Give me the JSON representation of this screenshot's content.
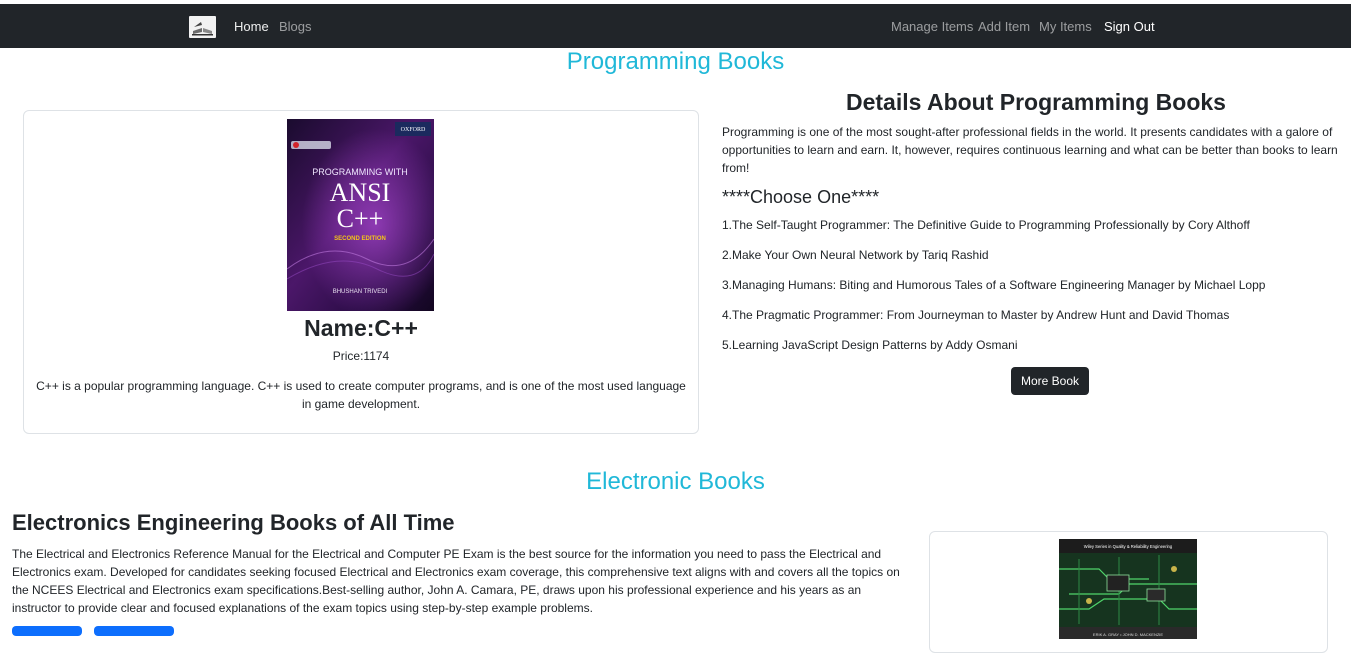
{
  "nav": {
    "links": {
      "home": "Home",
      "blogs": "Blogs",
      "manage": "Manage Items",
      "add": "Add Item",
      "my": "My Items",
      "signout": "Sign Out"
    }
  },
  "programming": {
    "section_title": "Programming Books",
    "card": {
      "cover": {
        "publisher": "OXFORD",
        "line1": "PROGRAMMING WITH",
        "line2": "ANSI",
        "line3": "C++",
        "edition": "SECOND EDITION",
        "author": "BHUSHAN TRIVEDI"
      },
      "name": "Name:C++",
      "price": "Price:1174",
      "description": "C++ is a popular programming language. C++ is used to create computer programs, and is one of the most used language in game development."
    },
    "details": {
      "title": "Details About Programming Books",
      "paragraph": "Programming is one of the most sought-after professional fields in the world. It presents candidates with a galore of opportunities to learn and earn. It, however, requires continuous learning and what can be better than books to learn from!",
      "choose": "****Choose One****",
      "list": [
        "1.The Self-Taught Programmer: The Definitive Guide to Programming Professionally by Cory Althoff",
        "2.Make Your Own Neural Network by Tariq Rashid",
        "3.Managing Humans: Biting and Humorous Tales of a Software Engineering Manager by Michael Lopp",
        "4.The Pragmatic Programmer: From Journeyman to Master by Andrew Hunt and David Thomas",
        "5.Learning JavaScript Design Patterns by Addy Osmani"
      ],
      "more_button": "More Book"
    }
  },
  "electronic": {
    "section_title": "Electronic Books",
    "heading": "Electronics Engineering Books of All Time",
    "paragraph": "The Electrical and Electronics Reference Manual for the Electrical and Computer PE Exam is the best source for the information you need to pass the Electrical and Electronics exam. Developed for candidates seeking focused Electrical and Electronics exam coverage, this comprehensive text aligns with and covers all the topics on the NCEES Electrical and Electronics exam specifications.Best-selling author, John A. Camara, PE, draws upon his professional experience and his years as an instructor to provide clear and focused explanations of the exam topics using step-by-step example problems.",
    "cover": {
      "series": "Wiley Series in Quality & Reliability Engineering",
      "authors": "ERIK A. GRAY • JOHN D. MACKENZIE"
    }
  }
}
